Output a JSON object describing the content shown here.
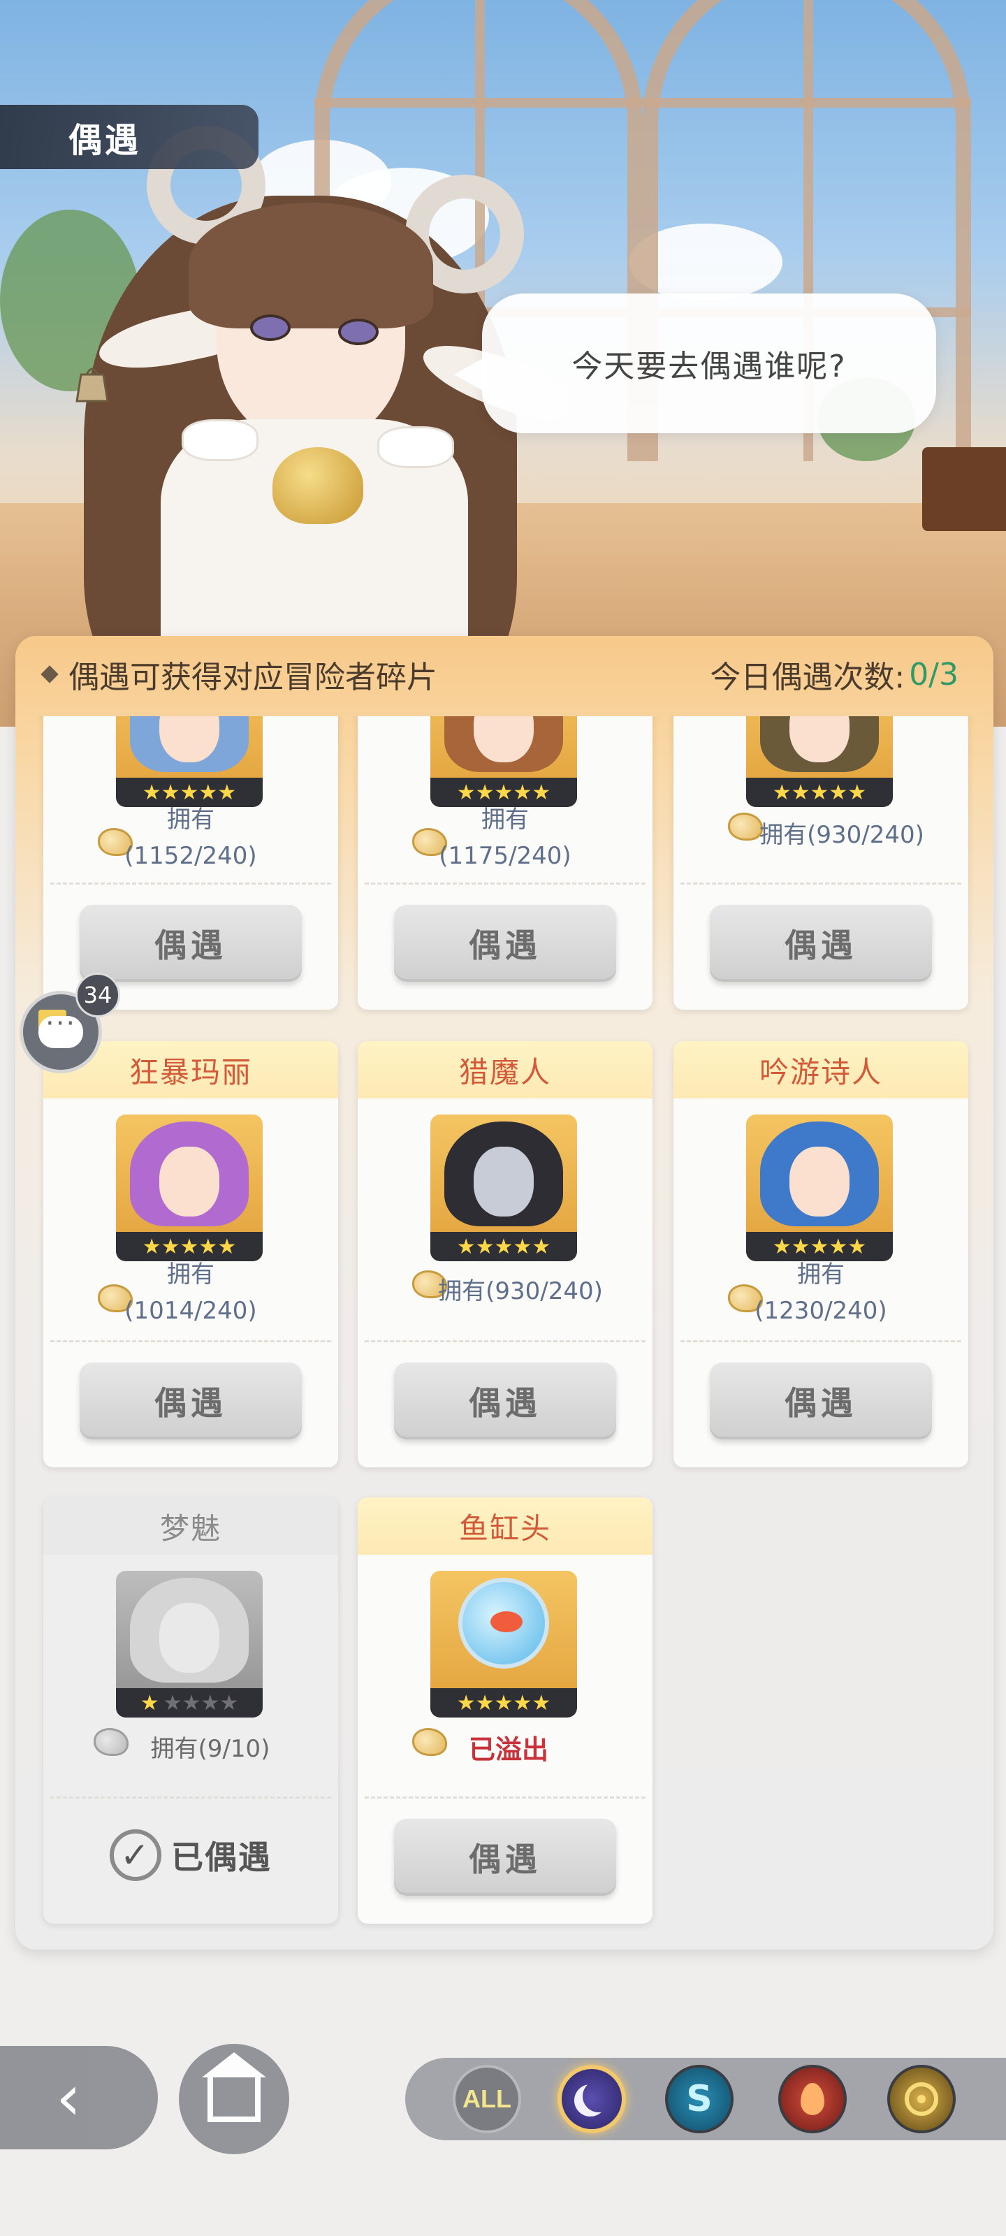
{
  "header": {
    "title": "偶遇"
  },
  "speech": {
    "text": "今天要去偶遇谁呢?"
  },
  "panel": {
    "info_text": "偶遇可获得对应冒险者碎片",
    "daily_label": "今日偶遇次数:",
    "daily_count": "0/3"
  },
  "cards_top": [
    {
      "own_label": "拥有",
      "own_value": "(1152/240)",
      "stars": 5,
      "button": "偶遇"
    },
    {
      "own_label": "拥有",
      "own_value": "(1175/240)",
      "stars": 5,
      "button": "偶遇"
    },
    {
      "own_inline": "拥有(930/240)",
      "stars": 5,
      "button": "偶遇"
    }
  ],
  "cards_mid": [
    {
      "name": "狂暴玛丽",
      "own_label": "拥有",
      "own_value": "(1014/240)",
      "stars": 5,
      "button": "偶遇"
    },
    {
      "name": "猎魔人",
      "own_inline": "拥有(930/240)",
      "stars": 5,
      "button": "偶遇"
    },
    {
      "name": "吟游诗人",
      "own_label": "拥有",
      "own_value": "(1230/240)",
      "stars": 5,
      "button": "偶遇"
    }
  ],
  "cards_bottom": [
    {
      "name": "梦魅",
      "own_inline": "拥有(9/10)",
      "stars": 1,
      "status": "已偶遇"
    },
    {
      "name": "鱼缸头",
      "overflow": "已溢出",
      "stars": 5,
      "button": "偶遇"
    }
  ],
  "chat": {
    "badge": "34"
  },
  "filters": [
    "ALL",
    "moon",
    "water",
    "fire",
    "light"
  ],
  "colors": {
    "accent_orange": "#d25a38",
    "count_green": "#2e9a66",
    "overflow_red": "#c8323a"
  }
}
